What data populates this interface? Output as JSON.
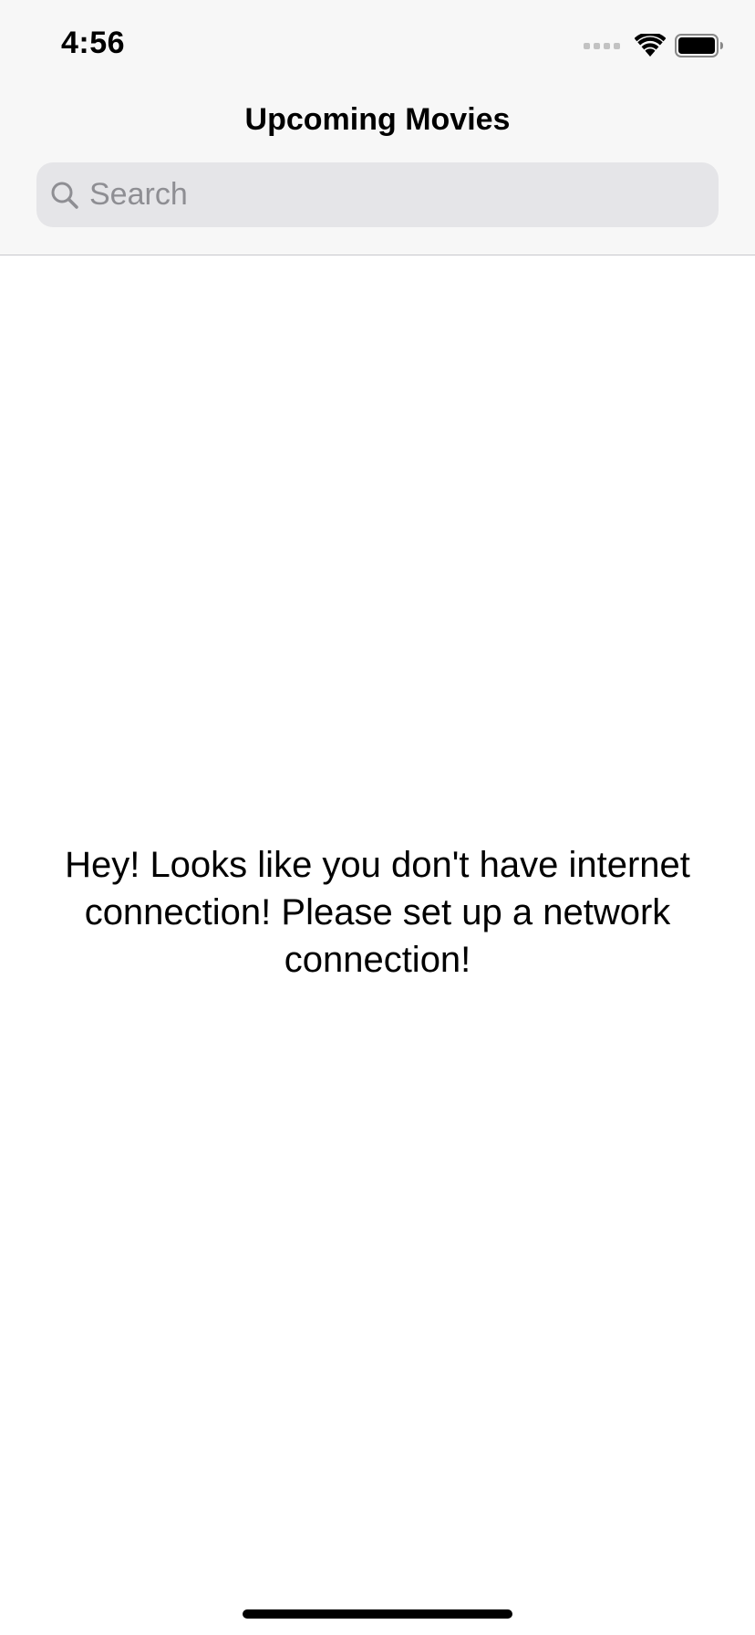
{
  "status_bar": {
    "time": "4:56",
    "icons": [
      "cellular-signal-icon",
      "wifi-icon",
      "battery-icon"
    ]
  },
  "navigation": {
    "title": "Upcoming Movies"
  },
  "search": {
    "placeholder": "Search",
    "value": "",
    "icon": "search-icon"
  },
  "main": {
    "message": "Hey! Looks like you don't have internet connection! Please set up a network connection!"
  },
  "colors": {
    "background": "#ffffff",
    "header_background": "#f7f7f7",
    "search_field": "#e5e5e8",
    "placeholder": "#8e8e93",
    "text": "#000000"
  }
}
